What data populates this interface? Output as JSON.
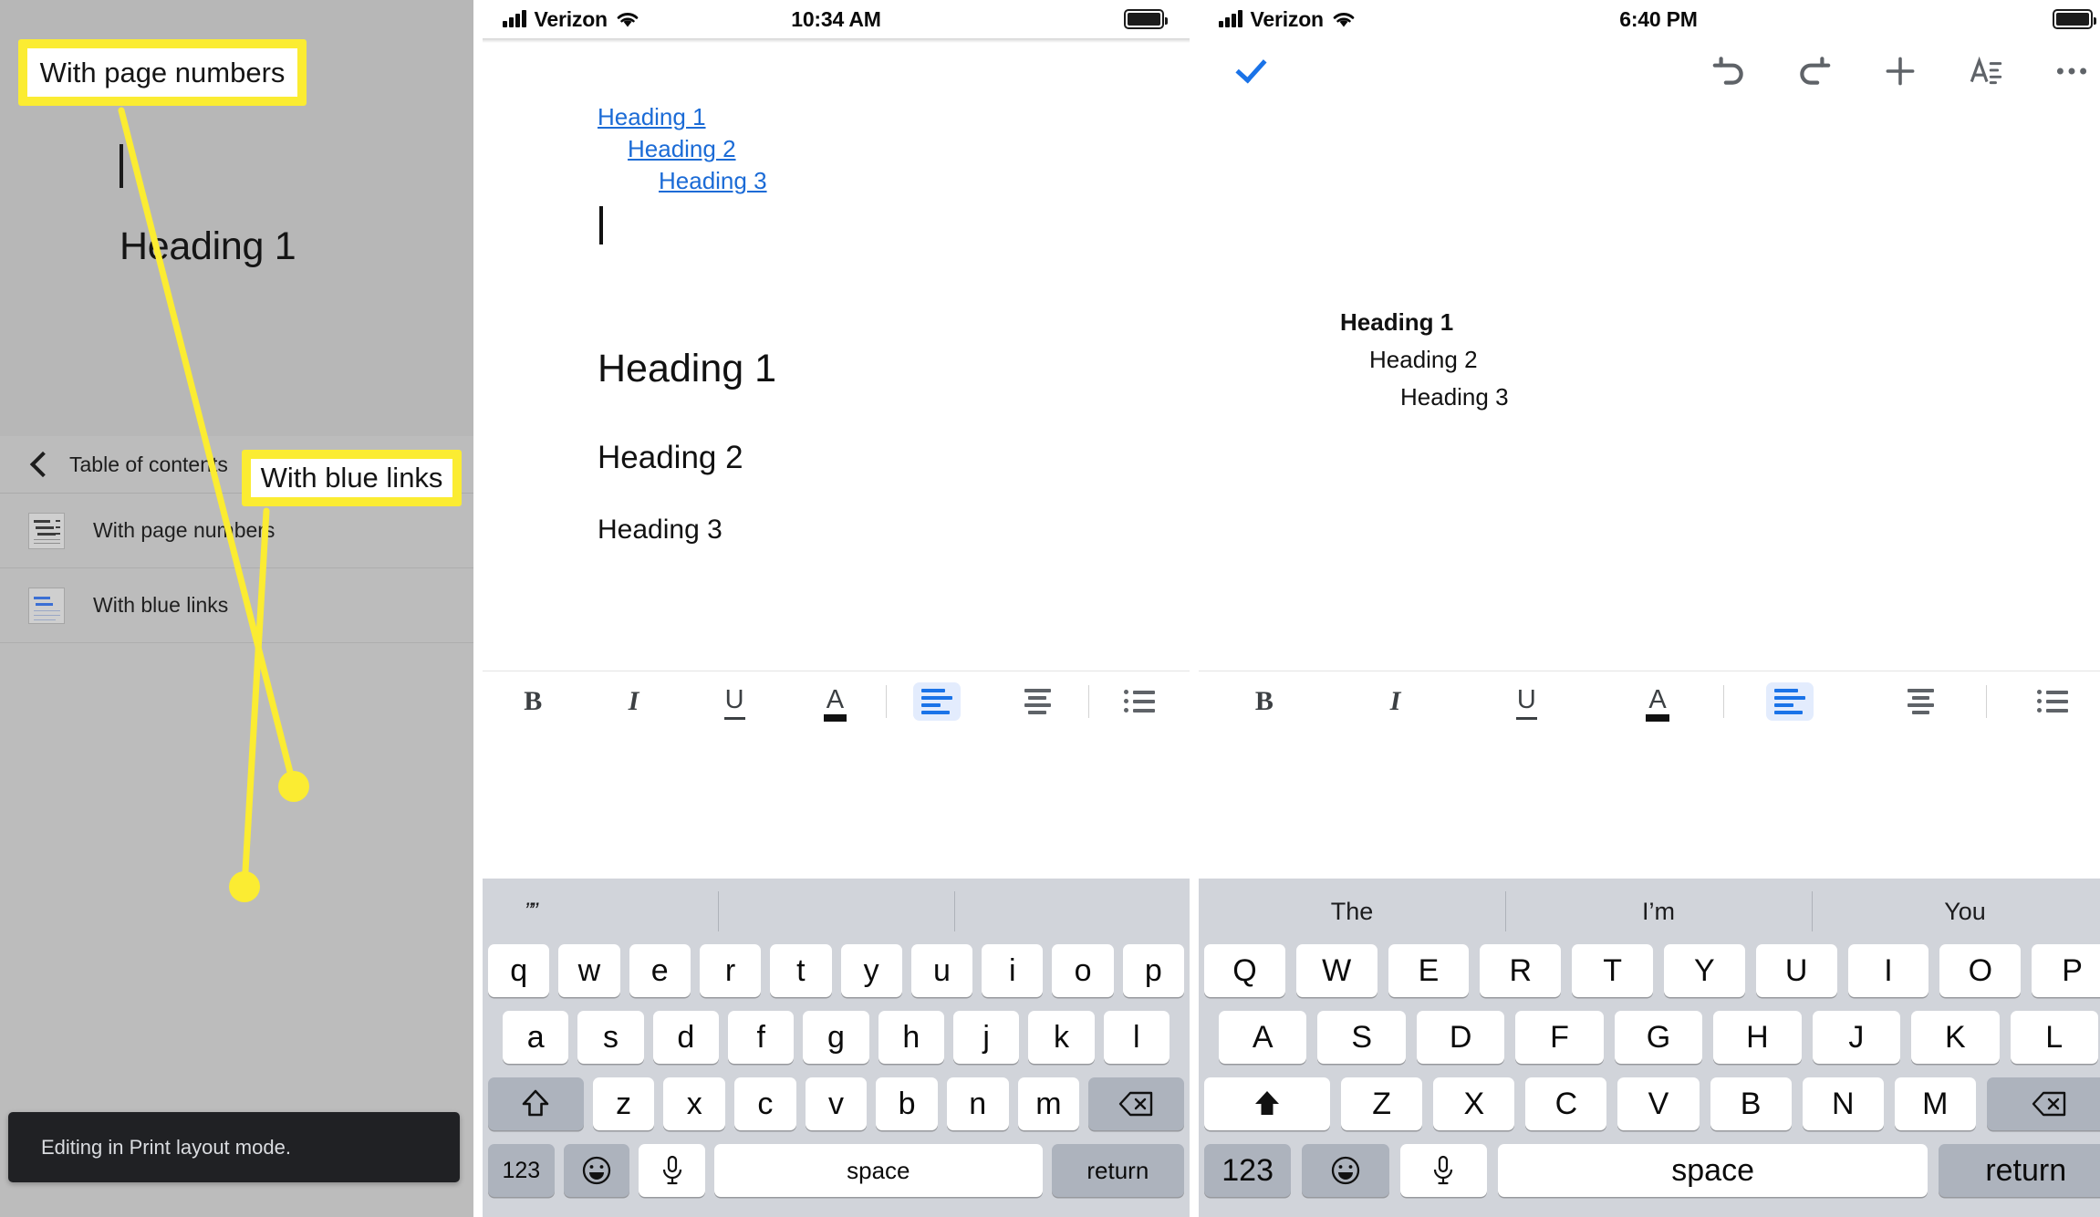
{
  "left_panel": {
    "document": {
      "heading1": "Heading 1"
    },
    "callouts": [
      {
        "id": "with-page-numbers",
        "label": "With page numbers"
      },
      {
        "id": "with-blue-links",
        "label": "With blue links"
      }
    ],
    "toc_menu": {
      "back_icon": "chevron-left-icon",
      "title": "Table of contents",
      "items": [
        {
          "label": "With page numbers",
          "icon": "toc-page-numbers-icon"
        },
        {
          "label": "With blue links",
          "icon": "toc-blue-links-icon"
        }
      ]
    },
    "toast": {
      "message": "Editing in Print layout mode."
    },
    "colors": {
      "highlight": "#fbec32",
      "background": "#b7b7b7",
      "sheet": "#bcbcbc",
      "toast_bg": "#202124"
    }
  },
  "middle_panel": {
    "status_bar": {
      "carrier": "Verizon",
      "time": "10:34 AM",
      "signal_icon": "cellular-bars-icon",
      "wifi_icon": "wifi-icon",
      "battery_icon": "battery-full-icon"
    },
    "document": {
      "toc_links": [
        "Heading 1",
        "Heading 2",
        "Heading 3"
      ],
      "headings": [
        "Heading 1",
        "Heading 2",
        "Heading 3"
      ],
      "link_color": "#1b6bd6"
    },
    "format_toolbar": {
      "bold": "B",
      "italic": "I",
      "underline": "U",
      "text_color": "A",
      "align_left": "align-left-icon",
      "align_center": "align-center-icon",
      "bulleted_list": "bulleted-list-icon",
      "active": "align_left",
      "active_color": "#1a73e8"
    },
    "keyboard": {
      "shift_state": "off",
      "predictions": [
        "””",
        "",
        ""
      ],
      "row1": [
        "q",
        "w",
        "e",
        "r",
        "t",
        "y",
        "u",
        "i",
        "o",
        "p"
      ],
      "row2": [
        "a",
        "s",
        "d",
        "f",
        "g",
        "h",
        "j",
        "k",
        "l"
      ],
      "row3": [
        "z",
        "x",
        "c",
        "v",
        "b",
        "n",
        "m"
      ],
      "shift_icon": "shift-outline-icon",
      "backspace_icon": "backspace-icon",
      "numbers_key": "123",
      "emoji_icon": "emoji-smiley-icon",
      "mic_icon": "microphone-icon",
      "space_key": "space",
      "return_key": "return"
    }
  },
  "right_panel": {
    "status_bar": {
      "carrier": "Verizon",
      "time": "6:40 PM",
      "signal_icon": "cellular-bars-icon",
      "wifi_icon": "wifi-icon",
      "battery_icon": "battery-full-icon"
    },
    "app_toolbar": {
      "done_icon": "checkmark-icon",
      "undo_icon": "undo-icon",
      "redo_icon": "redo-icon",
      "insert_icon": "plus-icon",
      "format_icon": "text-format-icon",
      "more_icon": "overflow-menu-icon",
      "done_color": "#1a73e8"
    },
    "document": {
      "headings": [
        "Heading 1",
        "Heading 2",
        "Heading 3"
      ]
    },
    "format_toolbar": {
      "bold": "B",
      "italic": "I",
      "underline": "U",
      "text_color": "A",
      "align_left": "align-left-icon",
      "align_center": "align-center-icon",
      "bulleted_list": "bulleted-list-icon",
      "active": "align_left",
      "active_color": "#1a73e8"
    },
    "keyboard": {
      "shift_state": "on",
      "predictions": [
        "The",
        "I’m",
        "You"
      ],
      "row1": [
        "Q",
        "W",
        "E",
        "R",
        "T",
        "Y",
        "U",
        "I",
        "O",
        "P"
      ],
      "row2": [
        "A",
        "S",
        "D",
        "F",
        "G",
        "H",
        "J",
        "K",
        "L"
      ],
      "row3": [
        "Z",
        "X",
        "C",
        "V",
        "B",
        "N",
        "M"
      ],
      "shift_icon": "shift-filled-icon",
      "backspace_icon": "backspace-icon",
      "numbers_key": "123",
      "emoji_icon": "emoji-smiley-icon",
      "mic_icon": "microphone-icon",
      "space_key": "space",
      "return_key": "return"
    }
  }
}
